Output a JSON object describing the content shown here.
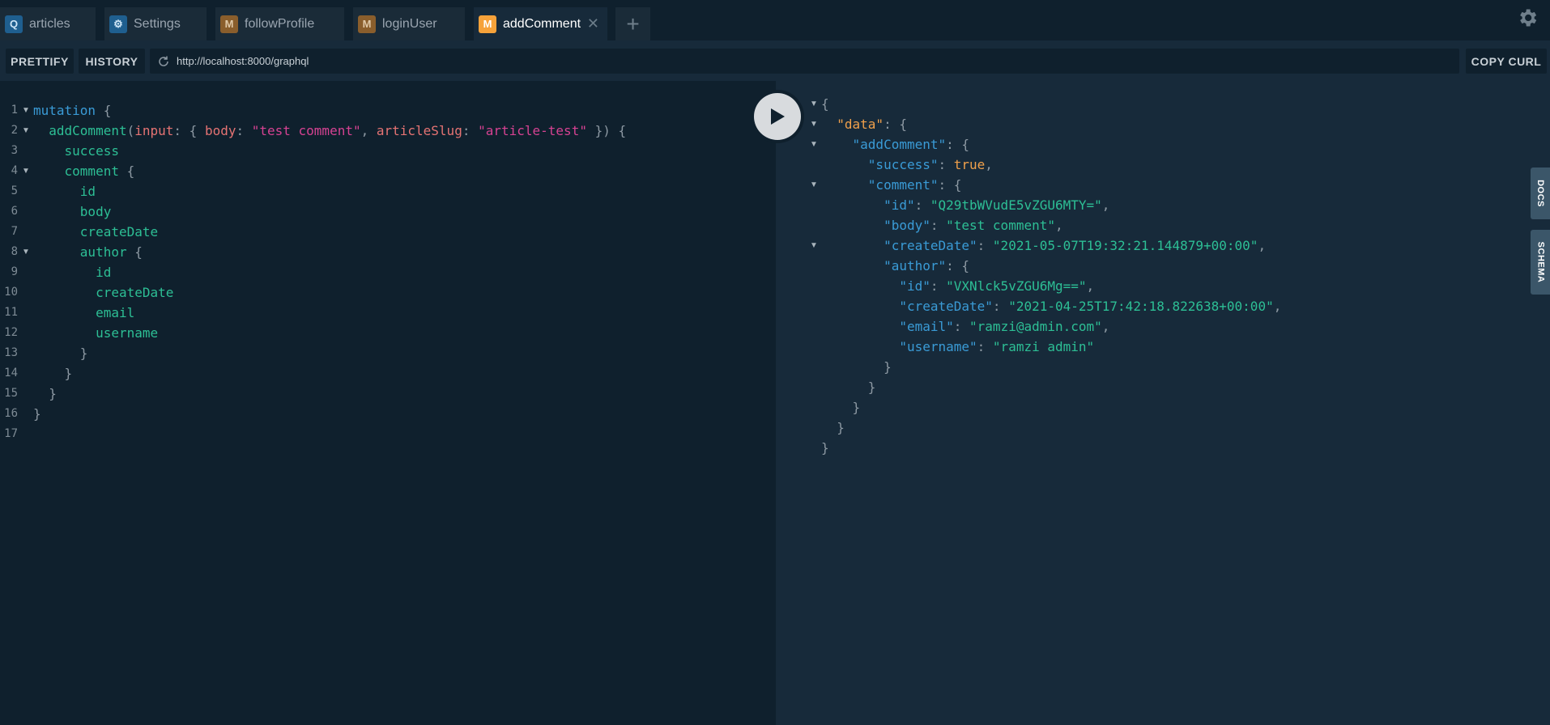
{
  "tabs": [
    {
      "badge": "Q",
      "label": "articles"
    },
    {
      "badge": "⚙",
      "label": "Settings"
    },
    {
      "badge": "M",
      "label": "followProfile"
    },
    {
      "badge": "M",
      "label": "loginUser"
    },
    {
      "badge": "M",
      "label": "addComment",
      "active": true,
      "close": "✕"
    }
  ],
  "add_tab_label": "+",
  "toolbar": {
    "prettify_label": "PRETTIFY",
    "history_label": "HISTORY",
    "url": "http://localhost:8000/graphql",
    "copy_curl_label": "COPY CURL"
  },
  "side_tabs": {
    "docs": "DOCS",
    "schema": "SCHEMA"
  },
  "editor": {
    "line_numbers": [
      "1",
      "2",
      "3",
      "4",
      "5",
      "6",
      "7",
      "8",
      "9",
      "10",
      "11",
      "12",
      "13",
      "14",
      "15",
      "16",
      "17"
    ],
    "lines": [
      "mutation {",
      "  addComment(input: { body: \"test comment\", articleSlug: \"article-test\" }) {",
      "    success",
      "    comment {",
      "      id",
      "      body",
      "      createDate",
      "      author {",
      "        id",
      "        createDate",
      "        email",
      "        username",
      "      }",
      "    }",
      "  }",
      "}",
      ""
    ]
  },
  "response": {
    "data_key": "\"data\"",
    "addComment_key": "\"addComment\"",
    "success_key": "\"success\"",
    "success_value": "true",
    "comment_key": "\"comment\"",
    "comment_id_key": "\"id\"",
    "comment_id": "\"Q29tbWVudE5vZGU6MTY=\"",
    "body_key": "\"body\"",
    "body": "\"test comment\"",
    "createDate_key": "\"createDate\"",
    "createDate": "\"2021-05-07T19:32:21.144879+00:00\"",
    "author_key": "\"author\"",
    "author_id_key": "\"id\"",
    "author_id": "\"VXNlck5vZGU6Mg==\"",
    "author_createDate_key": "\"createDate\"",
    "author_createDate": "\"2021-04-25T17:42:18.822638+00:00\"",
    "email_key": "\"email\"",
    "email": "\"ramzi@admin.com\"",
    "username_key": "\"username\"",
    "username": "\"ramzi admin\""
  },
  "colors": {
    "background": "#172a3a",
    "editor_background": "#0f202d",
    "active_badge": "#f6a23a",
    "keyword": "#3a9bd6",
    "field": "#2dbf95",
    "string_arg": "#d64292"
  }
}
